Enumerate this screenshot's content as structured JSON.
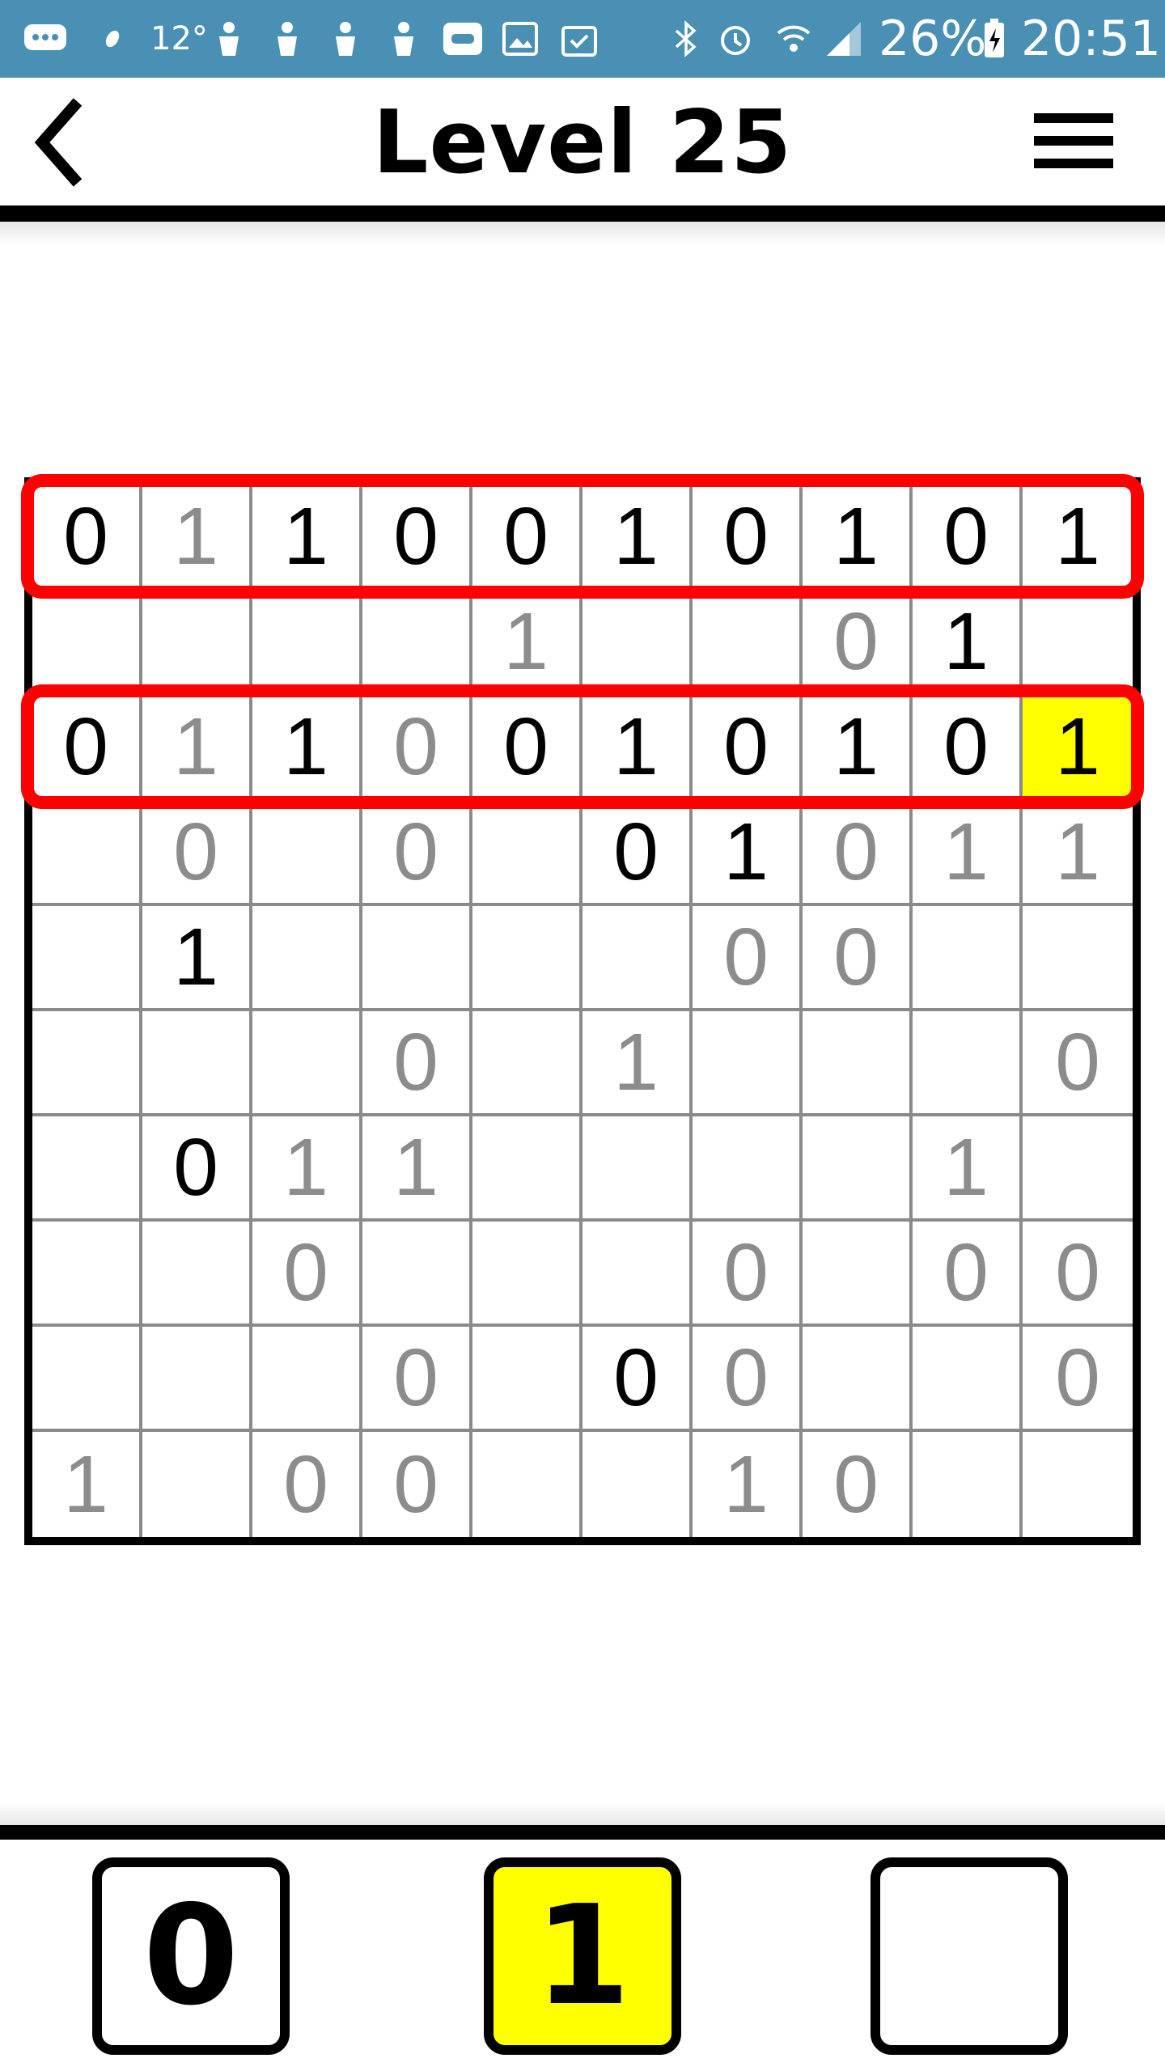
{
  "status_bar": {
    "temperature": "12°",
    "battery_percent": "26%",
    "time": "20:51",
    "background_color": "#4a8fb4",
    "icons": [
      "message-icon",
      "leaf-icon",
      "person-icon",
      "person-icon",
      "person-icon",
      "person-icon",
      "screen-icon",
      "image-icon",
      "clipboard-icon",
      "bluetooth-icon",
      "alarm-icon",
      "wifi-icon",
      "signal-icon",
      "battery-charging-icon"
    ]
  },
  "header": {
    "title": "Level 25",
    "back_icon": "chevron-left-icon",
    "menu_icon": "hamburger-menu-icon"
  },
  "board": {
    "rows": [
      [
        [
          "0",
          "fixed"
        ],
        [
          "1",
          "user"
        ],
        [
          "1",
          "fixed"
        ],
        [
          "0",
          "fixed"
        ],
        [
          "0",
          "fixed"
        ],
        [
          "1",
          "fixed"
        ],
        [
          "0",
          "fixed"
        ],
        [
          "1",
          "fixed"
        ],
        [
          "0",
          "fixed"
        ],
        [
          "1",
          "fixed"
        ]
      ],
      [
        [
          "",
          ""
        ],
        [
          "",
          ""
        ],
        [
          "",
          ""
        ],
        [
          "",
          ""
        ],
        [
          "1",
          "user"
        ],
        [
          "",
          ""
        ],
        [
          "",
          ""
        ],
        [
          "0",
          "user"
        ],
        [
          "1",
          "fixed"
        ],
        [
          "",
          ""
        ]
      ],
      [
        [
          "0",
          "fixed"
        ],
        [
          "1",
          "user"
        ],
        [
          "1",
          "fixed"
        ],
        [
          "0",
          "user"
        ],
        [
          "0",
          "fixed"
        ],
        [
          "1",
          "fixed"
        ],
        [
          "0",
          "fixed"
        ],
        [
          "1",
          "fixed"
        ],
        [
          "0",
          "fixed"
        ],
        [
          "1",
          "fixed"
        ]
      ],
      [
        [
          "",
          ""
        ],
        [
          "0",
          "user"
        ],
        [
          "",
          ""
        ],
        [
          "0",
          "user"
        ],
        [
          "",
          ""
        ],
        [
          "0",
          "fixed"
        ],
        [
          "1",
          "fixed"
        ],
        [
          "0",
          "user"
        ],
        [
          "1",
          "user"
        ],
        [
          "1",
          "user"
        ]
      ],
      [
        [
          "",
          ""
        ],
        [
          "1",
          "fixed"
        ],
        [
          "",
          ""
        ],
        [
          "",
          ""
        ],
        [
          "",
          ""
        ],
        [
          "",
          ""
        ],
        [
          "0",
          "user"
        ],
        [
          "0",
          "user"
        ],
        [
          "",
          ""
        ],
        [
          "",
          ""
        ]
      ],
      [
        [
          "",
          ""
        ],
        [
          "",
          ""
        ],
        [
          "",
          ""
        ],
        [
          "0",
          "user"
        ],
        [
          "",
          ""
        ],
        [
          "1",
          "user"
        ],
        [
          "",
          ""
        ],
        [
          "",
          ""
        ],
        [
          "",
          ""
        ],
        [
          "0",
          "user"
        ]
      ],
      [
        [
          "",
          ""
        ],
        [
          "0",
          "fixed"
        ],
        [
          "1",
          "user"
        ],
        [
          "1",
          "user"
        ],
        [
          "",
          ""
        ],
        [
          "",
          ""
        ],
        [
          "",
          ""
        ],
        [
          "",
          ""
        ],
        [
          "1",
          "user"
        ],
        [
          "",
          ""
        ]
      ],
      [
        [
          "",
          ""
        ],
        [
          "",
          ""
        ],
        [
          "0",
          "user"
        ],
        [
          "",
          ""
        ],
        [
          "",
          ""
        ],
        [
          "",
          ""
        ],
        [
          "0",
          "user"
        ],
        [
          "",
          ""
        ],
        [
          "0",
          "user"
        ],
        [
          "0",
          "user"
        ]
      ],
      [
        [
          "",
          ""
        ],
        [
          "",
          ""
        ],
        [
          "",
          ""
        ],
        [
          "0",
          "user"
        ],
        [
          "",
          ""
        ],
        [
          "0",
          "fixed"
        ],
        [
          "0",
          "user"
        ],
        [
          "",
          ""
        ],
        [
          "",
          ""
        ],
        [
          "0",
          "user"
        ]
      ],
      [
        [
          "1",
          "user"
        ],
        [
          "",
          ""
        ],
        [
          "0",
          "user"
        ],
        [
          "0",
          "user"
        ],
        [
          "",
          ""
        ],
        [
          "",
          ""
        ],
        [
          "1",
          "user"
        ],
        [
          "0",
          "user"
        ],
        [
          "",
          ""
        ],
        [
          "",
          ""
        ]
      ]
    ],
    "selected_cell": {
      "row": 2,
      "col": 9
    },
    "highlighted_rows": [
      0,
      2
    ],
    "highlight_color": "#ff0000",
    "selection_color": "#ffff00"
  },
  "input_keys": [
    {
      "label": "0",
      "active": false
    },
    {
      "label": "1",
      "active": true
    },
    {
      "label": "",
      "active": false
    }
  ]
}
